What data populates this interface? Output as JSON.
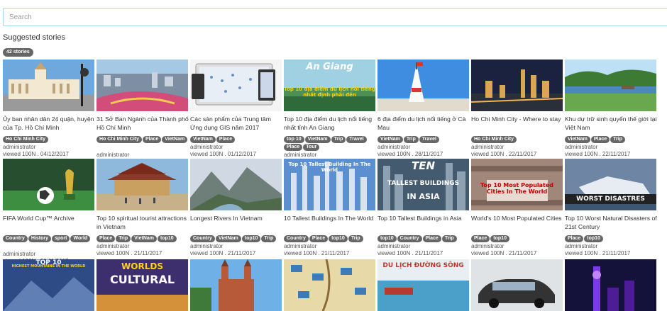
{
  "search": {
    "placeholder": "Search"
  },
  "heading": "Suggested stories",
  "count_badge": "42 stories",
  "cards": [
    {
      "title": "Ủy ban nhân dân 24 quận, huyện của Tp. Hồ Chí Minh",
      "tags": [
        "Ho Chi Minh City"
      ],
      "author": "administrator",
      "meta": "viewed 100N . 04/12/2017",
      "thumb": "city-hall"
    },
    {
      "title": "31 Sở Ban Ngành của Thành phố Hồ Chí Minh",
      "tags": [
        "Ho Chi Minh City",
        "Place",
        "VietNam"
      ],
      "author": "administrator",
      "meta": "viewed 100N . 01/12/2017",
      "thumb": "aerial-city"
    },
    {
      "title": "Các sản phẩm của Trung tâm Ứng dụng GIS năm 2017",
      "tags": [
        "VietNam",
        "Place"
      ],
      "author": "administrator",
      "meta": "viewed 100N . 01/12/2017",
      "thumb": "gis-devices"
    },
    {
      "title": "Top 10 địa điểm du lịch nổi tiếng nhất tỉnh An Giang",
      "tags": [
        "top 10",
        "VietNam",
        "Trip",
        "Travel",
        "Place",
        "Tour"
      ],
      "author": "administrator",
      "meta": "viewed 100N . 22/11/2017",
      "thumb": "an-giang",
      "overlay_top": "An Giang",
      "overlay_mid": "Top 10 địa điểm du lịch nổi tiếng nhất định phải đến"
    },
    {
      "title": "6 địa điểm du lịch nổi tiếng ở Cà Mau",
      "tags": [
        "VietNam",
        "Trip",
        "Travel"
      ],
      "author": "administrator",
      "meta": "viewed 100N . 28/11/2017",
      "thumb": "ca-mau"
    },
    {
      "title": "Ho Chi Minh City - Where to stay",
      "tags": [
        "Ho Chi Minh City"
      ],
      "author": "administrator",
      "meta": "viewed 100N . 22/11/2017",
      "thumb": "night-city"
    },
    {
      "title": "Khu dự trữ sinh quyển thế giới tại Việt Nam",
      "tags": [
        "VietNam",
        "Place",
        "Trip"
      ],
      "author": "administrator",
      "meta": "viewed 100N . 22/11/2017",
      "thumb": "wetland"
    },
    {
      "title": "FIFA World Cup™ Archive",
      "tags": [
        "Country",
        "History",
        "sport",
        "World"
      ],
      "author": "administrator",
      "meta": "viewed 100N . 21/11/2017",
      "thumb": "world-cup"
    },
    {
      "title": "Top 10 spiritual tourist attractions in Vietnam",
      "tags": [
        "Place",
        "Trip",
        "VietNam",
        "top10"
      ],
      "author": "administrator",
      "meta": "viewed 100N . 21/11/2017",
      "thumb": "pagoda"
    },
    {
      "title": "Longest Rivers In Vietnam",
      "tags": [
        "Country",
        "VietNam",
        "top10",
        "Trip"
      ],
      "author": "administrator",
      "meta": "viewed 100N . 21/11/2017",
      "thumb": "mountains"
    },
    {
      "title": "10 Tallest Buildings In The World",
      "tags": [
        "Country",
        "Place",
        "top10",
        "Trip"
      ],
      "author": "administrator",
      "meta": "viewed 100N . 21/11/2017",
      "thumb": "towers",
      "overlay_top": "Top 10 Tallest Building In The World"
    },
    {
      "title": "Top 10 Tallest Buildings in Asia",
      "tags": [
        "top10",
        "Country",
        "Place",
        "Trip"
      ],
      "author": "administrator",
      "meta": "viewed 100N . 21/11/2017",
      "thumb": "asia-towers",
      "overlay_top": "TEN",
      "overlay_mid": "TALLEST BUILDINGS",
      "overlay_bot": "IN ASIA"
    },
    {
      "title": "World's 10 Most Populated Cities",
      "tags": [
        "Place",
        "top10"
      ],
      "author": "administrator",
      "meta": "viewed 100N . 21/11/2017",
      "thumb": "populated",
      "overlay_mid": "Top 10 Most Populated Cities In The World"
    },
    {
      "title": "Top 10 Worst Natural Disasters of 21st Century",
      "tags": [
        "Place",
        "top10"
      ],
      "author": "administrator",
      "meta": "viewed 100N . 21/11/2017",
      "thumb": "disasters",
      "overlay_bot": "WORST DISASTRES"
    },
    {
      "title": "",
      "tags": [],
      "author": "",
      "meta": "",
      "thumb": "high-mountains",
      "overlay_top": "TOP 10",
      "overlay_mid": "HIGHEST MOUNTAINS IN THE WORLD"
    },
    {
      "title": "",
      "tags": [],
      "author": "",
      "meta": "",
      "thumb": "worlds-cultural",
      "overlay_top": "WORLDS",
      "overlay_mid": "CULTURAL"
    },
    {
      "title": "",
      "tags": [],
      "author": "",
      "meta": "",
      "thumb": "cathedral"
    },
    {
      "title": "",
      "tags": [],
      "author": "",
      "meta": "",
      "thumb": "map-grid"
    },
    {
      "title": "",
      "tags": [],
      "author": "",
      "meta": "",
      "thumb": "river-tour",
      "overlay_top": "DU LỊCH ĐƯỜNG SÔNG"
    },
    {
      "title": "",
      "tags": [],
      "author": "",
      "meta": "",
      "thumb": "car"
    },
    {
      "title": "",
      "tags": [],
      "author": "",
      "meta": "",
      "thumb": "purple-tower"
    }
  ]
}
